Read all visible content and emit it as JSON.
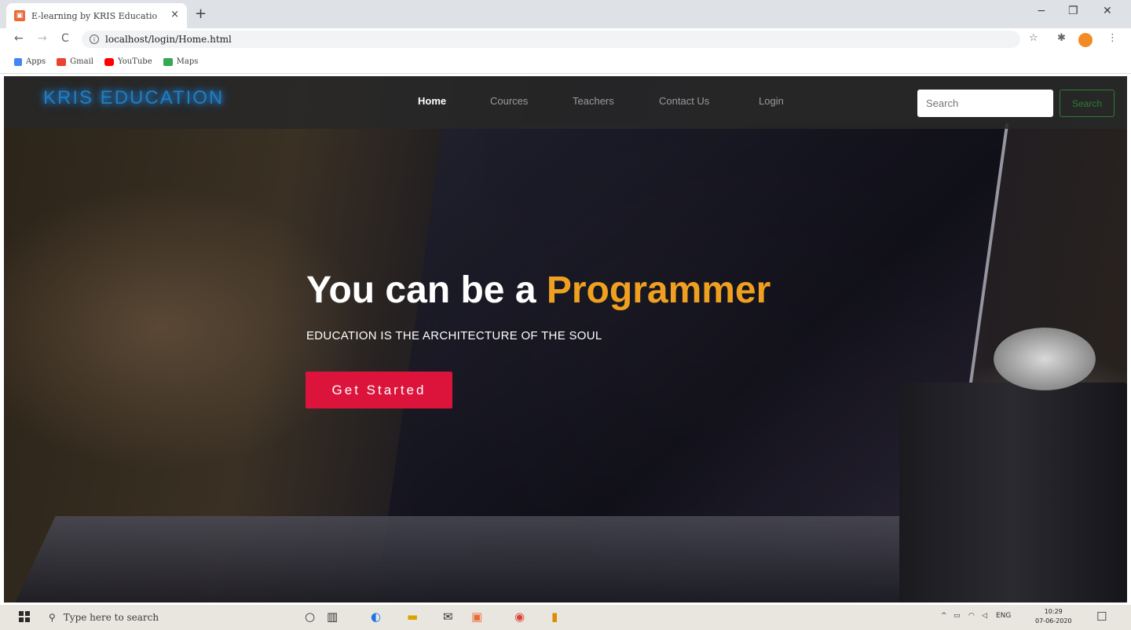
{
  "browser": {
    "tab_title": "E-learning by KRIS Education",
    "tab_close": "×",
    "new_tab": "+",
    "minimize": "−",
    "restore": "❐",
    "close": "✕",
    "back": "←",
    "forward": "→",
    "reload": "C",
    "info": "i",
    "url": "localhost/login/Home.html",
    "star": "☆",
    "extensions": "✱",
    "menu": "⋮",
    "bookmarks": [
      {
        "label": "Apps",
        "color": "#4285f4"
      },
      {
        "label": "Gmail",
        "color": "#ea4335"
      },
      {
        "label": "YouTube",
        "color": "#ff0000"
      },
      {
        "label": "Maps",
        "color": "#34a853"
      }
    ]
  },
  "navbar": {
    "brand": "KRIS EDUCATION",
    "links": [
      {
        "label": "Home",
        "active": true
      },
      {
        "label": "Cources",
        "active": false
      },
      {
        "label": "Teachers",
        "active": false
      },
      {
        "label": "Contact Us",
        "active": false
      },
      {
        "label": "Login",
        "active": false
      }
    ],
    "search_placeholder": "Search",
    "search_button": "Search"
  },
  "hero": {
    "title_prefix": "You can be a ",
    "title_accent": "Programmer",
    "subtitle": "EDUCATION IS THE ARCHITECTURE OF THE SOUL",
    "cta": "Get Started",
    "accent_color": "#f0a020",
    "cta_color": "#dc143c"
  },
  "taskbar": {
    "search_icon": "⚲",
    "search_placeholder": "Type here to search",
    "tray_up": "^",
    "tray_lang": "ENG",
    "time": "10:29",
    "date": "07-06-2020",
    "notification": "☐"
  }
}
